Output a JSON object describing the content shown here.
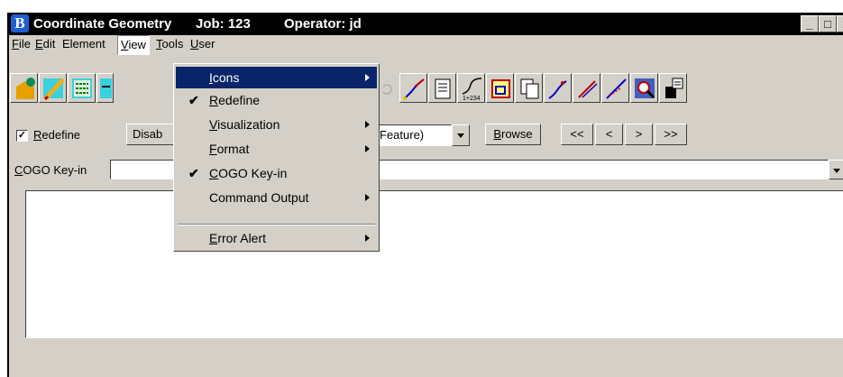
{
  "window": {
    "app_logo_letter": "B",
    "title": "Coordinate Geometry",
    "job": "Job: 123",
    "operator": "Operator: jd",
    "min_btn": "_",
    "max_btn": "□",
    "close_btn": "x"
  },
  "menubar": [
    {
      "label": "File",
      "u": "F",
      "rest": "ile"
    },
    {
      "label": "Edit",
      "u": "E",
      "rest": "dit"
    },
    {
      "label": "Element",
      "u": "",
      "rest": "Element"
    },
    {
      "label": "View",
      "u": "V",
      "rest": "iew"
    },
    {
      "label": "Tools",
      "u": "T",
      "rest": "ools"
    },
    {
      "label": "User",
      "u": "U",
      "rest": "ser"
    }
  ],
  "toolbar_icons": [
    "new-point-icon",
    "pencil-icon",
    "list-icon",
    "text-icon",
    "curve-icon",
    "line-icon",
    "document-icon",
    "stationing-icon",
    "figure-icon",
    "copy-icon",
    "spiral-icon",
    "offset-icon",
    "intersect-icon",
    "zoom-icon",
    "import-icon"
  ],
  "controls": {
    "redefine_checked": "✓",
    "redefine_u": "R",
    "redefine_rest": "edefine",
    "disable_label": "Disab",
    "feature_value": "Feature)",
    "browse_u": "B",
    "browse_rest": "rowse",
    "first_btn": "<<",
    "prev_btn": "<",
    "next_btn": ">",
    "last_btn": ">>"
  },
  "keyin": {
    "label_u": "C",
    "label_rest": "OGO Key-in",
    "value": ""
  },
  "view_menu": {
    "items": [
      {
        "u": "I",
        "rest": "cons",
        "checked": "",
        "submenu": true,
        "highlighted": true
      },
      {
        "u": "R",
        "rest": "edefine",
        "checked": "✔",
        "submenu": false,
        "highlighted": false
      },
      {
        "u": "V",
        "rest": "isualization",
        "checked": "",
        "submenu": true,
        "highlighted": false
      },
      {
        "u": "F",
        "rest": "ormat",
        "checked": "",
        "submenu": true,
        "highlighted": false
      },
      {
        "u": "C",
        "rest": "OGO Key-in",
        "checked": "✔",
        "submenu": false,
        "highlighted": false
      },
      {
        "u": "",
        "rest": "Command Output",
        "checked": "",
        "submenu": true,
        "highlighted": false
      },
      {
        "u": "E",
        "rest": "rror Alert",
        "checked": "",
        "submenu": true,
        "highlighted": false
      }
    ]
  },
  "colors": {
    "title_bg": "#000000",
    "menu_highlight": "#0a246a",
    "face": "#d4d0c8"
  }
}
